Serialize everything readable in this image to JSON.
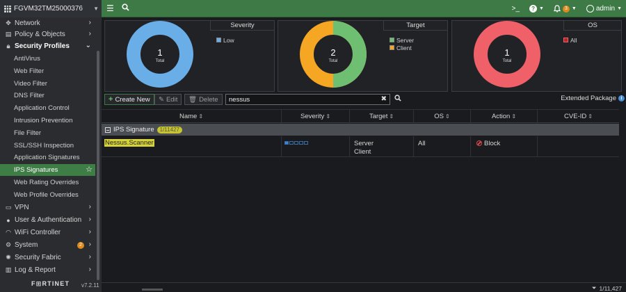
{
  "topbar": {
    "device_name": "FGVM32TM25000376",
    "notifications_count": "3",
    "user": "admin"
  },
  "sidebar": {
    "items": [
      {
        "label": "Network",
        "icon": "network-icon"
      },
      {
        "label": "Policy & Objects",
        "icon": "policy-icon"
      },
      {
        "label": "Security Profiles",
        "icon": "lock-icon"
      }
    ],
    "security_sub": [
      "AntiVirus",
      "Web Filter",
      "Video Filter",
      "DNS Filter",
      "Application Control",
      "Intrusion Prevention",
      "File Filter",
      "SSL/SSH Inspection",
      "Application Signatures",
      "IPS Signatures",
      "Web Rating Overrides",
      "Web Profile Overrides"
    ],
    "lower_items": [
      "VPN",
      "User & Authentication",
      "WiFi Controller",
      "System",
      "Security Fabric",
      "Log & Report"
    ],
    "system_badge": "2",
    "brand": "F⊞RTINET",
    "version": "v7.2.11"
  },
  "cards": {
    "severity": {
      "title": "Severity",
      "total": "1",
      "total_label": "Total",
      "legend": [
        "Low"
      ]
    },
    "target": {
      "title": "Target",
      "total": "2",
      "total_label": "Total",
      "legend": [
        "Server",
        "Client"
      ]
    },
    "os": {
      "title": "OS",
      "total": "1",
      "total_label": "Total",
      "legend": [
        "All"
      ]
    }
  },
  "colors": {
    "severity_low": "#6aaee8",
    "target_server": "#6fbf73",
    "target_client": "#f5a623",
    "os_all": "#f06068"
  },
  "toolbar": {
    "create_new": "Create New",
    "edit": "Edit",
    "delete": "Delete",
    "search_value": "nessus",
    "extended_package": "Extended Package"
  },
  "table": {
    "columns": [
      "Name",
      "Severity",
      "Target",
      "OS",
      "Action",
      "CVE-ID"
    ],
    "group": {
      "label": "IPS Signature",
      "count": "1/11427"
    },
    "rows": [
      {
        "name": "Nessus.Scanner",
        "target_1": "Server",
        "target_2": "Client",
        "os": "All",
        "action": "Block",
        "cve": ""
      }
    ]
  },
  "footer": {
    "page_count": "1/11,427"
  }
}
